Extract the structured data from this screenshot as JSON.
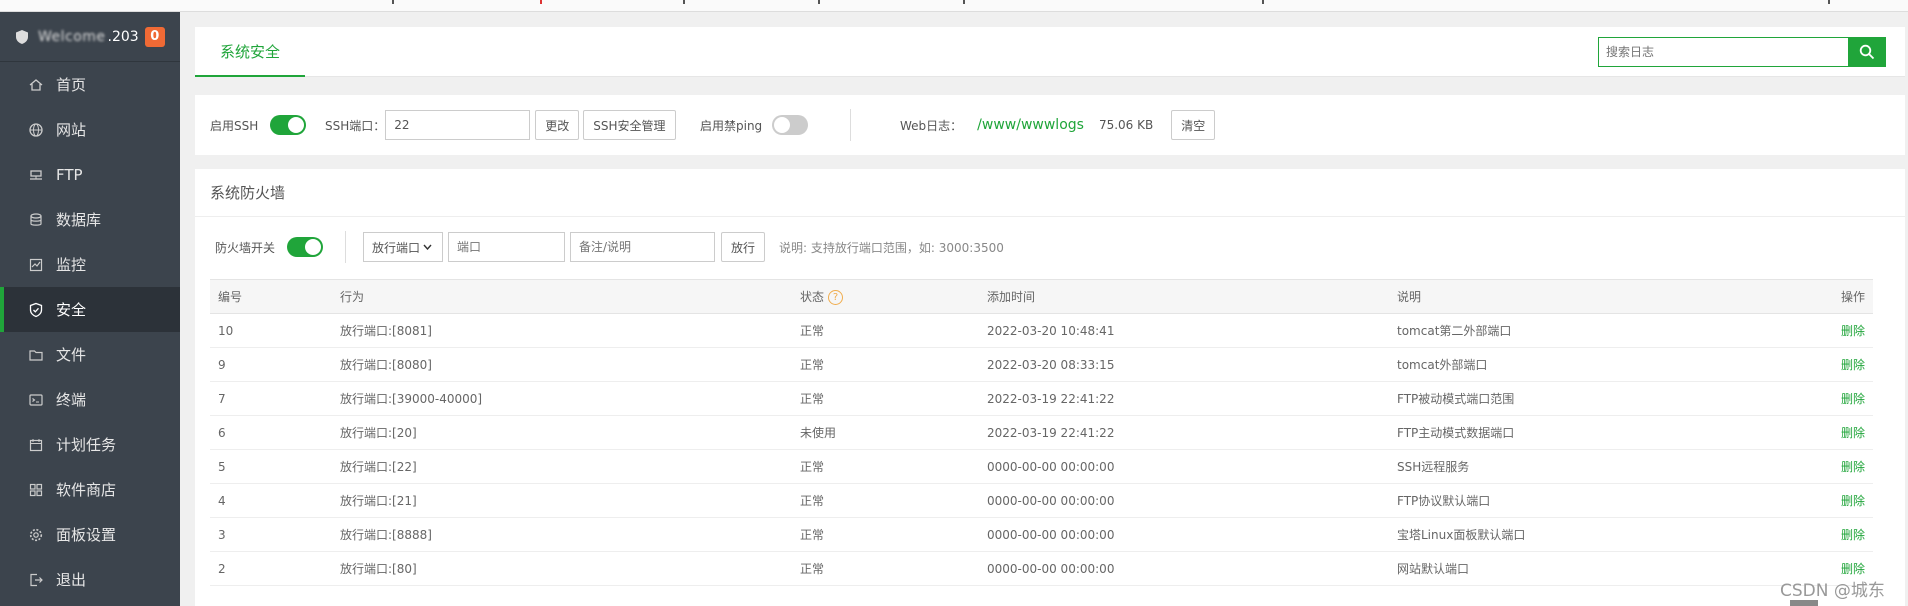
{
  "sidebar": {
    "host_masked": "Welcome",
    "host_tail": ".203",
    "badge": "0",
    "items": [
      {
        "label": "首页",
        "icon": "home-icon"
      },
      {
        "label": "网站",
        "icon": "globe-icon"
      },
      {
        "label": "FTP",
        "icon": "ftp-icon"
      },
      {
        "label": "数据库",
        "icon": "database-icon"
      },
      {
        "label": "监控",
        "icon": "monitor-icon"
      },
      {
        "label": "安全",
        "icon": "shield-icon",
        "active": true
      },
      {
        "label": "文件",
        "icon": "folder-icon"
      },
      {
        "label": "终端",
        "icon": "terminal-icon"
      },
      {
        "label": "计划任务",
        "icon": "calendar-icon"
      },
      {
        "label": "软件商店",
        "icon": "apps-icon"
      },
      {
        "label": "面板设置",
        "icon": "gear-icon"
      },
      {
        "label": "退出",
        "icon": "logout-icon"
      }
    ]
  },
  "tabs": {
    "active": "系统安全"
  },
  "log_search": {
    "placeholder": "搜索日志"
  },
  "ssh": {
    "enable_label": "启用SSH",
    "enable_on": true,
    "port_label": "SSH端口：",
    "port_value": "22",
    "change_label": "更改",
    "manage_label": "SSH安全管理",
    "ping_label": "启用禁ping",
    "ping_on": false,
    "weblog_label": "Web日志：",
    "weblog_path": "/www/wwwlogs",
    "weblog_size": "75.06 KB",
    "clear_label": "清空"
  },
  "firewall": {
    "title": "系统防火墙",
    "switch_label": "防火墙开关",
    "switch_on": true,
    "action_select": "放行端口",
    "port_placeholder": "端口",
    "note_placeholder": "备注/说明",
    "add_label": "放行",
    "hint": "说明: 支持放行端口范围，如: 3000:3500",
    "columns": [
      "编号",
      "行为",
      "状态",
      "添加时间",
      "说明",
      "操作"
    ],
    "rows": [
      {
        "id": "10",
        "action": "放行端口:[8081]",
        "status": "正常",
        "time": "2022-03-20 10:48:41",
        "desc": "tomcat第二外部端口",
        "op": "删除"
      },
      {
        "id": "9",
        "action": "放行端口:[8080]",
        "status": "正常",
        "time": "2022-03-20 08:33:15",
        "desc": "tomcat外部端口",
        "op": "删除"
      },
      {
        "id": "7",
        "action": "放行端口:[39000-40000]",
        "status": "正常",
        "time": "2022-03-19 22:41:22",
        "desc": "FTP被动模式端口范围",
        "op": "删除"
      },
      {
        "id": "6",
        "action": "放行端口:[20]",
        "status": "未使用",
        "time": "2022-03-19 22:41:22",
        "desc": "FTP主动模式数据端口",
        "op": "删除"
      },
      {
        "id": "5",
        "action": "放行端口:[22]",
        "status": "正常",
        "time": "0000-00-00 00:00:00",
        "desc": "SSH远程服务",
        "op": "删除"
      },
      {
        "id": "4",
        "action": "放行端口:[21]",
        "status": "正常",
        "time": "0000-00-00 00:00:00",
        "desc": "FTP协议默认端口",
        "op": "删除"
      },
      {
        "id": "3",
        "action": "放行端口:[8888]",
        "status": "正常",
        "time": "0000-00-00 00:00:00",
        "desc": "宝塔Linux面板默认端口",
        "op": "删除"
      },
      {
        "id": "2",
        "action": "放行端口:[80]",
        "status": "正常",
        "time": "0000-00-00 00:00:00",
        "desc": "网站默认端口",
        "op": "删除"
      }
    ]
  },
  "watermark": "CSDN @城东",
  "colors": {
    "accent": "#20a53a",
    "sidebar": "#3c444d",
    "badge": "#f06a35"
  }
}
